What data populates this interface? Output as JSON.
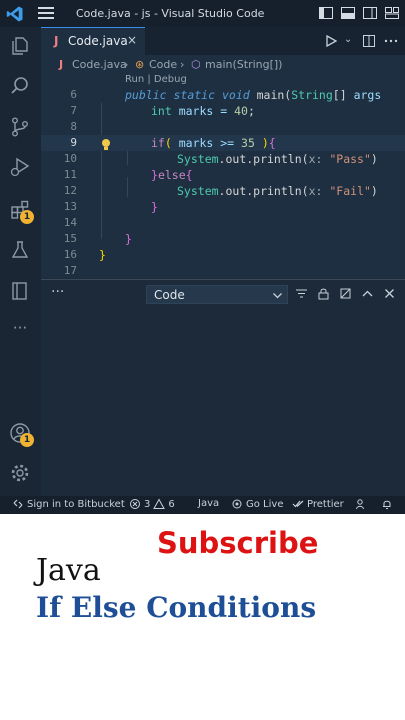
{
  "titlebar": {
    "title": "Code.java - js - Visual Studio Code",
    "icons": [
      "vscode-logo-icon",
      "menu-icon",
      "toggle-primary-sidebar-icon",
      "toggle-panel-icon",
      "toggle-secondary-sidebar-icon",
      "customize-layout-icon"
    ]
  },
  "activitybar": {
    "items": [
      "explorer-icon",
      "search-icon",
      "source-control-icon",
      "run-debug-icon",
      "extensions-icon",
      "testing-icon",
      "remote-explorer-icon",
      "more-icon",
      "accounts-icon",
      "manage-gear-icon"
    ],
    "extensions_badge": "1",
    "accounts_badge": "1",
    "more_label": "···"
  },
  "tab": {
    "file_icon": "J",
    "label": "Code.java",
    "close": "×"
  },
  "breadcrumb": {
    "file": "Code.java",
    "class": "Code",
    "method": "main(String[])"
  },
  "codelens": "Run | Debug",
  "code": {
    "lines": [
      6,
      7,
      8,
      9,
      10,
      11,
      12,
      13,
      14,
      15,
      16,
      17
    ],
    "active_line": 9,
    "l6": {
      "kw1": "public",
      "kw2": "static",
      "kw3": "void",
      "fn": "main(",
      "type": "String",
      "brk": "[]",
      "rest": " args"
    },
    "l7": {
      "type": "int",
      "rest": " marks = ",
      "num": "40",
      "end": ";"
    },
    "l9": {
      "kw": "if",
      "open": "(",
      "rest": " marks >= ",
      "num": "35",
      "close": " )",
      "brace": "{"
    },
    "l10": {
      "obj": "System",
      "rest": ".out.println(",
      "param": "x: ",
      "str": "\"Pass\"",
      "end": ")"
    },
    "l11": {
      "close": "}",
      "kw": "else",
      "open": "{"
    },
    "l12": {
      "obj": "System",
      "rest": ".out.println(",
      "param": "x: ",
      "str": "\"Fail\"",
      "end": ")"
    },
    "l13": {
      "close": "}"
    },
    "l15": {
      "close": "}"
    },
    "l16": {
      "close": "}"
    }
  },
  "panel": {
    "more": "···",
    "dropdown_value": "Code"
  },
  "statusbar": {
    "remote": "Sign in to Bitbucket",
    "errors": "3",
    "warnings": "6",
    "language": "Java",
    "golive": "Go Live",
    "prettier": "Prettier"
  },
  "caption": {
    "subscribe": "Subscribe",
    "language": "Java",
    "topic": "If Else Conditions"
  },
  "colors": {
    "subscribe": "#dd1212",
    "topic": "#1e4f96",
    "accent": "#3b8ee6",
    "badge": "#f0b232"
  }
}
